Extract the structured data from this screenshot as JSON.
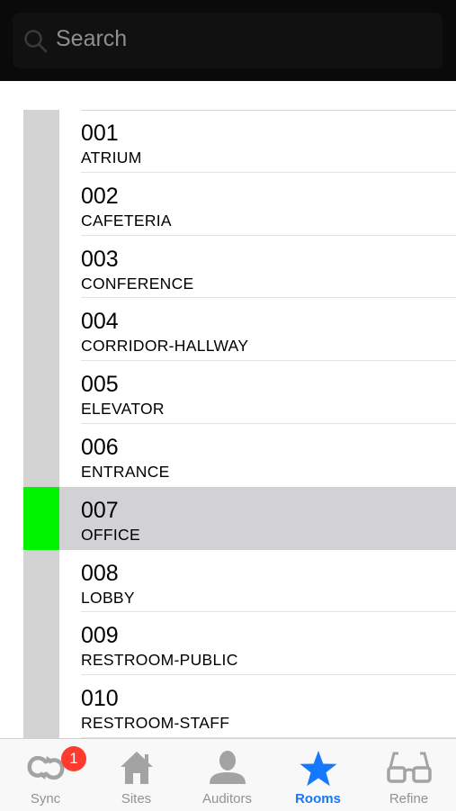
{
  "search": {
    "placeholder": "Search"
  },
  "rooms": [
    {
      "code": "001",
      "name": "ATRIUM",
      "selected": false
    },
    {
      "code": "002",
      "name": "CAFETERIA",
      "selected": false
    },
    {
      "code": "003",
      "name": "CONFERENCE",
      "selected": false
    },
    {
      "code": "004",
      "name": "CORRIDOR-HALLWAY",
      "selected": false
    },
    {
      "code": "005",
      "name": "ELEVATOR",
      "selected": false
    },
    {
      "code": "006",
      "name": "ENTRANCE",
      "selected": false
    },
    {
      "code": "007",
      "name": "OFFICE",
      "selected": true
    },
    {
      "code": "008",
      "name": "LOBBY",
      "selected": false
    },
    {
      "code": "009",
      "name": "RESTROOM-PUBLIC",
      "selected": false
    },
    {
      "code": "010",
      "name": "RESTROOM-STAFF",
      "selected": false
    }
  ],
  "colors": {
    "marker_default": "#d3d3d3",
    "marker_selected": "#00f400",
    "selected_row": "#d1d1d6",
    "tab_active": "#1678ff",
    "tab_inactive": "#929292",
    "badge": "#ff3b30"
  },
  "tabbar": {
    "tabs": [
      {
        "label": "Sync",
        "icon": "sync-icon",
        "active": false,
        "badge": "1"
      },
      {
        "label": "Sites",
        "icon": "house-icon",
        "active": false
      },
      {
        "label": "Auditors",
        "icon": "person-icon",
        "active": false
      },
      {
        "label": "Rooms",
        "icon": "star-icon",
        "active": true
      },
      {
        "label": "Refine",
        "icon": "glasses-icon",
        "active": false
      }
    ]
  }
}
